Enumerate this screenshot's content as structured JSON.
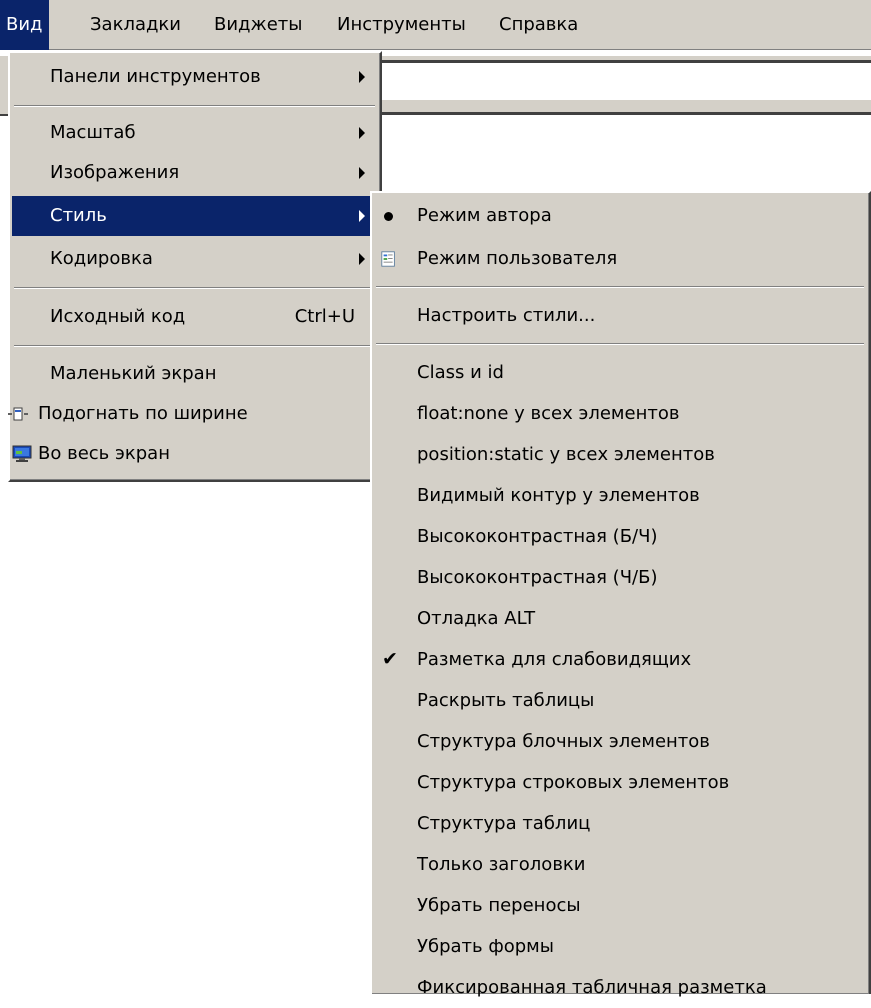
{
  "menubar": {
    "items": [
      "Вид",
      "Закладки",
      "Виджеты",
      "Инструменты",
      "Справка"
    ]
  },
  "view_menu": {
    "items": [
      {
        "label": "Панели инструментов",
        "submenu": true
      },
      {
        "label": "Масштаб",
        "submenu": true
      },
      {
        "label": "Изображения",
        "submenu": true
      },
      {
        "label": "Стиль",
        "submenu": true,
        "highlighted": true
      },
      {
        "label": "Кодировка",
        "submenu": true
      },
      {
        "label": "Исходный код",
        "shortcut": "Ctrl+U"
      },
      {
        "label": "Маленький экран"
      },
      {
        "label": "Подогнать по ширине",
        "icon": "fit-width-icon"
      },
      {
        "label": "Во весь экран",
        "icon": "fullscreen-monitor-icon"
      }
    ]
  },
  "style_menu": {
    "items": [
      {
        "label": "Режим автора",
        "mark": "radio-bullet"
      },
      {
        "label": "Режим пользователя",
        "icon": "user-mode-icon"
      },
      {
        "label": "Настроить стили..."
      },
      {
        "label": "Class и id"
      },
      {
        "label": "float:none у всех элементов"
      },
      {
        "label": "position:static у всех элементов"
      },
      {
        "label": "Видимый контур у элементов"
      },
      {
        "label": "Высококонтрастная (Б/Ч)"
      },
      {
        "label": "Высококонтрастная (Ч/Б)"
      },
      {
        "label": "Отладка ALT"
      },
      {
        "label": "Разметка для слабовидящих",
        "mark": "checkmark"
      },
      {
        "label": "Раскрыть таблицы"
      },
      {
        "label": "Структура блочных элементов"
      },
      {
        "label": "Структура строковых элементов"
      },
      {
        "label": "Структура таблиц"
      },
      {
        "label": "Только заголовки"
      },
      {
        "label": "Убрать переносы"
      },
      {
        "label": "Убрать формы"
      },
      {
        "label": "Фиксированная табличная разметка"
      }
    ]
  },
  "colors": {
    "menu_bg": "#d4d0c8",
    "highlight_bg": "#0a246a",
    "highlight_text": "#ffffff"
  },
  "check_glyph": "✔"
}
